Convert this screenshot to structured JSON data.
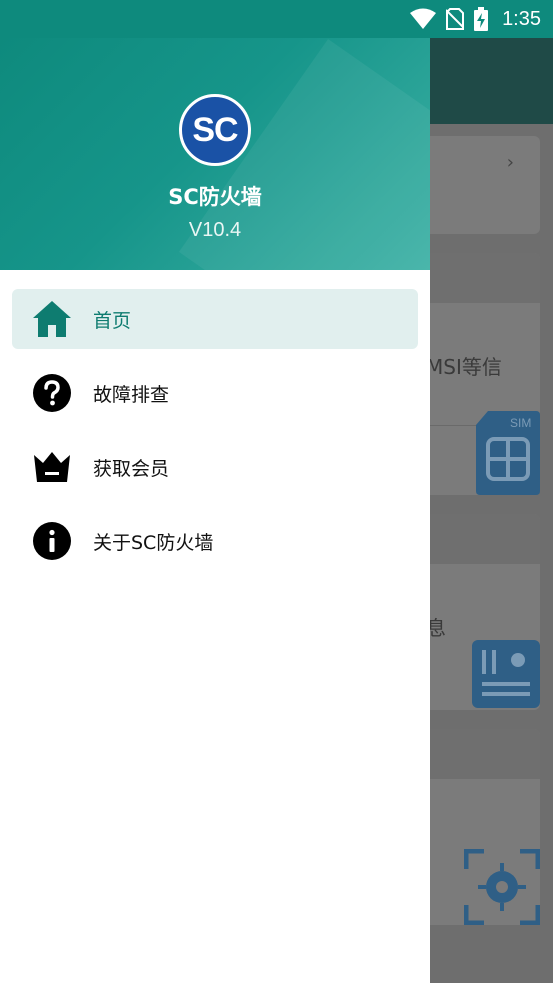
{
  "status_bar": {
    "time": "1:35",
    "icons": [
      "wifi-icon",
      "no-sim-icon",
      "battery-charging-icon"
    ]
  },
  "drawer": {
    "logo_text": "SC",
    "app_name": "SC防火墙",
    "version": "V10.4",
    "menu": [
      {
        "label": "首页",
        "icon": "home-icon",
        "active": true
      },
      {
        "label": "故障排查",
        "icon": "help-circle-icon",
        "active": false
      },
      {
        "label": "获取会员",
        "icon": "crown-icon",
        "active": false
      },
      {
        "label": "关于SC防火墙",
        "icon": "info-icon",
        "active": false
      }
    ]
  },
  "background": {
    "card2_text": "MSI等信",
    "card3_text": "息",
    "sim_label": "SIM"
  },
  "colors": {
    "accent": "#0e8a7d",
    "active_bg": "#e1efee",
    "logo_blue": "#1a52a6"
  }
}
